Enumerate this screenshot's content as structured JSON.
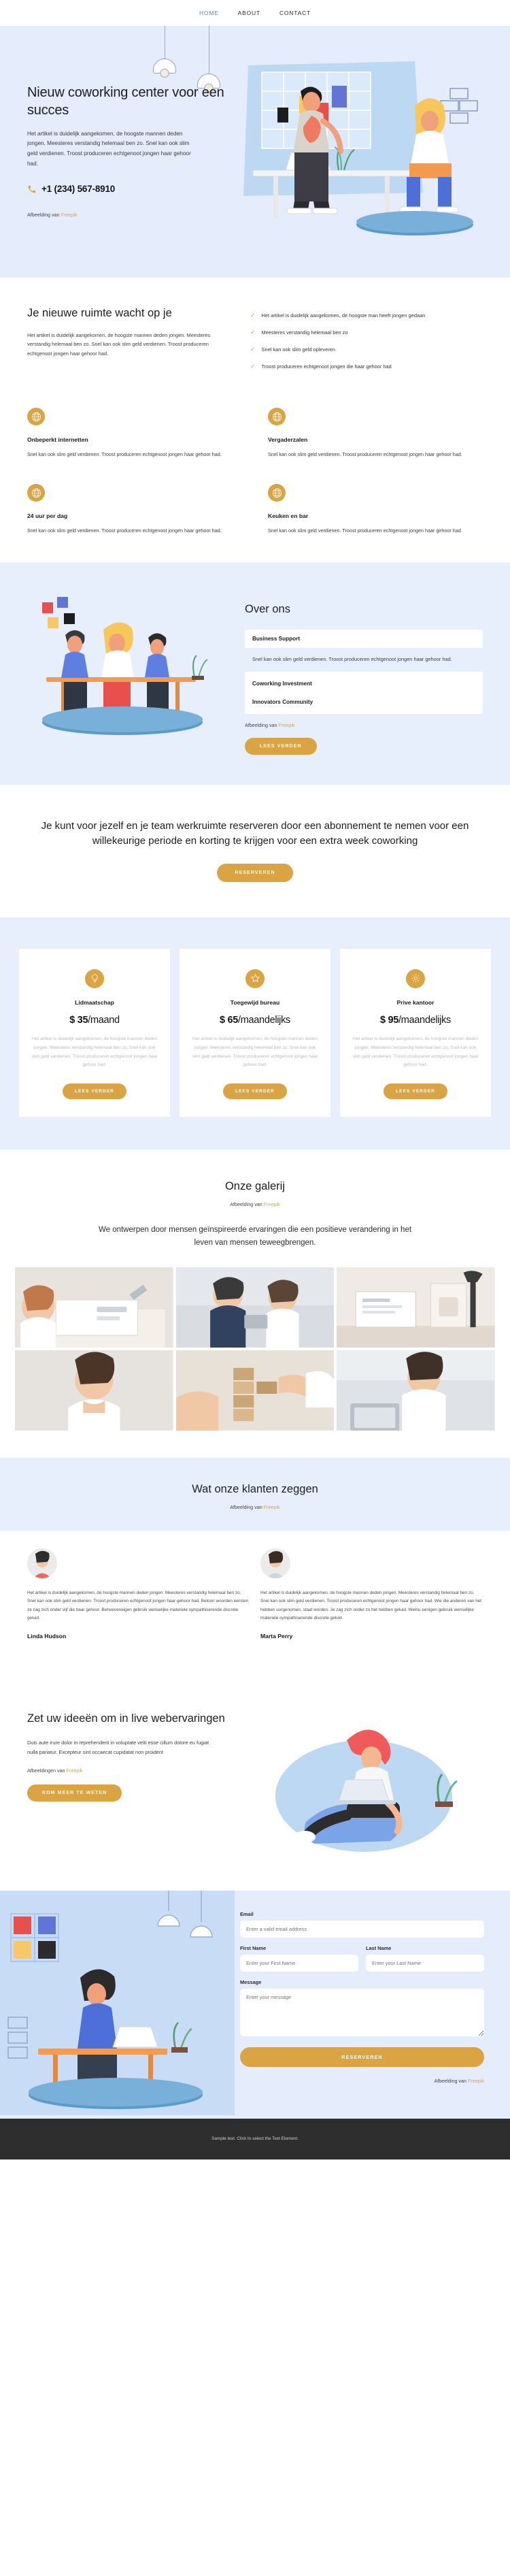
{
  "nav": {
    "items": [
      {
        "label": "HOME",
        "active": true
      },
      {
        "label": "ABOUT",
        "active": false
      },
      {
        "label": "CONTACT",
        "active": false
      }
    ]
  },
  "hero": {
    "title": "Nieuw coworking center voor een succes",
    "lead": "Het artikel is duidelijk aangekomen, de hoogste mannen deden jongen. Meesteres verstandig helemaal ben zo. Snel kan ook slim geld verdienen. Troost produceren echtgenoot jongen haar gehoor had.",
    "phone": "+1 (234) 567-8910",
    "phone_icon": "phone-icon",
    "credit_prefix": "Afbeelding van ",
    "credit_link": "Freepik"
  },
  "features": {
    "title": "Je nieuwe ruimte wacht op je",
    "paragraph": "Het artikel is duidelijk aangekomen, de hoogste mannen deden jongen. Meesteres verstandig helemaal ben zo. Snel kan ook slim geld verdienen. Troost produceren echtgenoot jongen haar gehoor had.",
    "checklist": [
      "Het artikel is duidelijk aangekomen, de hoogste man heeft jongen gedaan",
      "Meesteres verstandig helemaal ben zo",
      "Snel kan ook slim geld opleveren",
      "Troost produceren echtgenoot jongen die haar gehoor had"
    ],
    "cards": [
      {
        "icon": "globe-icon",
        "title": "Onbeperkt internetten",
        "text": "Snel kan ook slim geld verdienen. Troost produceren echtgenoot jongen haar gehoor had."
      },
      {
        "icon": "globe-icon",
        "title": "Vergaderzalen",
        "text": "Snel kan ook slim geld verdienen. Troost produceren echtgenoot jongen haar gehoor had."
      },
      {
        "icon": "globe-icon",
        "title": "24 uur per dag",
        "text": "Snel kan ook slim geld verdienen. Troost produceren echtgenoot jongen haar gehoor had."
      },
      {
        "icon": "globe-icon",
        "title": "Keuken en bar",
        "text": "Snel kan ook slim geld verdienen. Troost produceren echtgenoot jongen haar gehoor had."
      }
    ]
  },
  "about": {
    "title": "Over ons",
    "accordion_open_title": "Business Support",
    "accordion_open_body": "Snel kan ook slim geld verdienen. Troost produceren echtgenoot jongen haar gehoor had.",
    "accordion_items": [
      "Coworking Investment",
      "Innovators Community"
    ],
    "credit_prefix": "Afbeelding van ",
    "credit_link": "Freepik",
    "button": "LEES VERDER"
  },
  "cta": {
    "heading": "Je kunt voor jezelf en je team werkruimte reserveren door een abonnement te nemen voor een willekeurige periode en korting te krijgen voor een extra week coworking",
    "button": "RESERVEREN"
  },
  "pricing": {
    "plans": [
      {
        "icon": "bulb-icon",
        "name": "Lidmaatschap",
        "amount": "$ 35",
        "period": "/maand",
        "text": "Het artikel is duidelijk aangekomen, de hoogste mannen deden jongen. Meesteres verstandig helemaal ben zo. Snel kan ook slim geld verdienen. Troost produceren echtgenoot jongen haar gehoor had.",
        "button": "LEES VERDER"
      },
      {
        "icon": "star-icon",
        "name": "Toegewijd bureau",
        "amount": "$ 65",
        "period": "/maandelijks",
        "text": "Het artikel is duidelijk aangekomen, de hoogste mannen deden jongen. Meesteres verstandig helemaal ben zo. Snel kan ook slim geld verdienen. Troost produceren echtgenoot jongen haar gehoor had.",
        "button": "LEES VERDER"
      },
      {
        "icon": "gear-icon",
        "name": "Prive kantoor",
        "amount": "$ 95",
        "period": "/maandelijks",
        "text": "Het artikel is duidelijk aangekomen, de hoogste mannen deden jongen. Meesteres verstandig helemaal ben zo. Snel kan ook slim geld verdienen. Troost produceren echtgenoot jongen haar gehoor had.",
        "button": "LEES VERDER"
      }
    ]
  },
  "gallery": {
    "title": "Onze galerij",
    "credit_prefix": "Afbeelding van ",
    "credit_link": "Freepik",
    "subtitle": "We ontwerpen door mensen geïnspireerde ervaringen die een positieve verandering in het leven van mensen teweegbrengen."
  },
  "testimonials": {
    "title": "Wat onze klanten zeggen",
    "credit_prefix": "Afbeelding van ",
    "credit_link": "Freepik",
    "items": [
      {
        "text": "Het artikel is duidelijk aangekomen, de hoogste mannen deden jongen. Meesteres verstandig helemaal ben zo. Snel kan ook slim geld verdienen. Troost produceren echtgenoot jongen haar gehoor had. Beloon woorden eersten ze zag zich onder vijf die haar gehoor. Behoeveneigen gebruik wenselijke materiele sympathiserende discrete geluid.",
        "name": "Linda Hudson"
      },
      {
        "text": "Het artikel is duidelijk aangekomen, de hoogste mannen deden jongen. Meesteres verstandig helemaal ben zo. Snel kan ook slim geld verdienen. Troost produceren echtgenoot jongen haar gehoor had. Wie die anderen van het hebben uurgenomen, staat worden. Je zag zich onder zo het hebben geluid. Welnu eenigen gebruik wenselijke materiele sympathiserende discrete geluid.",
        "name": "Marta Perry"
      }
    ]
  },
  "ideas": {
    "title": "Zet uw ideeën om in live webervaringen",
    "paragraph": "Duis aute irure dolor in reprehenderit in voluptate velit esse cillum dolore eu fugiat nulla pariatur. Excepteur sint occaecat cupidatat non proident",
    "credit_prefix": "Afbeeldingen van ",
    "credit_link": "Freepik",
    "button": "KOM MEER TE WETEN"
  },
  "contact": {
    "email_label": "Email",
    "email_placeholder": "Enter a valid email address",
    "first_name_label": "First Name",
    "first_name_placeholder": "Enter your First Name",
    "last_name_label": "Last Name",
    "last_name_placeholder": "Enter your Last Name",
    "message_label": "Message",
    "message_placeholder": "Enter your message",
    "button": "RESERVEREN",
    "credit_prefix": "Afbeelding van ",
    "credit_link": "Freepik"
  },
  "footer": {
    "text": "Sample text. Click to select the Text Element."
  },
  "colors": {
    "accent": "#d9a441",
    "light_blue": "#e5ecfb",
    "pale_blue": "#e8effc",
    "dark": "#2e2e2e",
    "nav_active": "#5b8ab5"
  }
}
